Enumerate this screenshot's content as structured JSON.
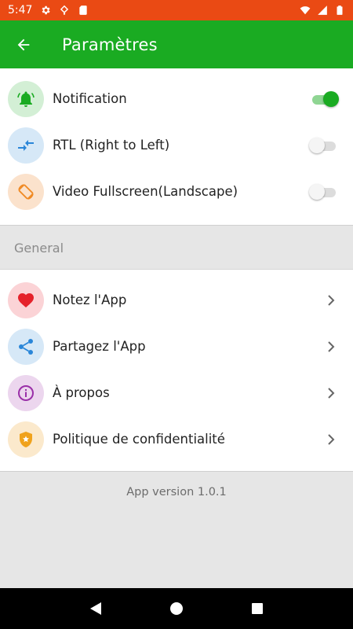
{
  "status_bar": {
    "time": "5:47",
    "icons": [
      "settings-icon",
      "location-icon",
      "sd-card-icon",
      "wifi-icon",
      "signal-icon",
      "battery-icon"
    ]
  },
  "app_bar": {
    "title": "Paramètres",
    "back_icon": "arrow-back-icon",
    "color": "#1aab22"
  },
  "settings": {
    "notification": {
      "label": "Notification",
      "icon": "alarm-bell-icon",
      "enabled": true
    },
    "rtl": {
      "label": "RTL (Right to Left)",
      "icon": "compare-arrows-icon",
      "enabled": false
    },
    "video": {
      "label": "Video Fullscreen(Landscape)",
      "icon": "screen-rotation-icon",
      "enabled": false
    }
  },
  "general": {
    "header": "General",
    "items": [
      {
        "label": "Notez l'App",
        "icon": "heart-icon"
      },
      {
        "label": "Partagez l'App",
        "icon": "share-icon"
      },
      {
        "label": "À propos",
        "icon": "info-icon"
      },
      {
        "label": "Politique de confidentialité",
        "icon": "shield-star-icon"
      }
    ]
  },
  "footer": {
    "version": "App version 1.0.1"
  },
  "nav_bar": {
    "buttons": [
      "back-triangle-icon",
      "home-circle-icon",
      "recents-square-icon"
    ]
  }
}
